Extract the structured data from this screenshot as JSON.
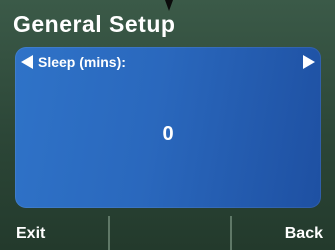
{
  "screen": {
    "title": "General Setup"
  },
  "setting": {
    "label": "Sleep (mins):",
    "value": "0"
  },
  "softkeys": {
    "left": "Exit",
    "right": "Back"
  },
  "icons": {
    "prev": "left-arrow-icon",
    "next": "right-arrow-icon"
  },
  "colors": {
    "panel": "#2a68bd",
    "background": "#2c4637",
    "text": "#ffffff"
  }
}
